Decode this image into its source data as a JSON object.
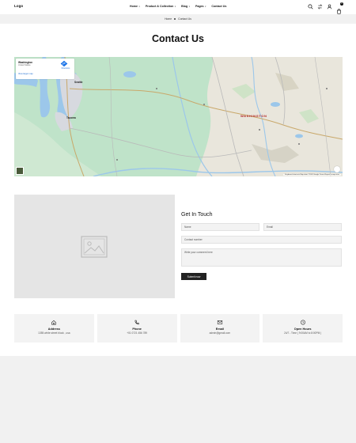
{
  "header": {
    "logo": "Logo",
    "nav": [
      {
        "label": "Home",
        "has_dropdown": true
      },
      {
        "label": "Product & Collection",
        "has_dropdown": true
      },
      {
        "label": "Blog",
        "has_dropdown": true
      },
      {
        "label": "Pages",
        "has_dropdown": true
      },
      {
        "label": "Contact Us",
        "has_dropdown": false
      }
    ],
    "icons": [
      "search-icon",
      "compare-icon",
      "account-icon",
      "cart-icon"
    ],
    "cart_count": "0"
  },
  "breadcrumb": {
    "items": [
      "Home",
      "Contact Us"
    ]
  },
  "page_title": "Contact Us",
  "map": {
    "card_title": "Washington",
    "card_subtitle": "United States",
    "directions_label": "Directions",
    "view_larger": "View larger map",
    "city_label": "Seattle",
    "city2_label": "Tacoma",
    "state_label": "WASHINGTON",
    "footer": "Keyboard shortcuts   Map data ©2024 Google   Terms   Report a map error"
  },
  "form": {
    "title": "Get In Touch",
    "name_placeholder": "Name",
    "email_placeholder": "Email",
    "contact_placeholder": "Contact number",
    "comment_placeholder": "Write your comment here",
    "submit_label": "Submit now"
  },
  "info_cards": [
    {
      "icon": "home-icon",
      "title": "Address",
      "value": "1355 white street block , usa"
    },
    {
      "icon": "phone-icon",
      "title": "Phone",
      "value": "+01 0721 456 789"
    },
    {
      "icon": "mail-icon",
      "title": "Email",
      "value": "admin@gmail.com"
    },
    {
      "icon": "clock-icon",
      "title": "Open Hours",
      "value": "24/7 - Time ( 9:00AM to 8:00PM )"
    }
  ],
  "colors": {
    "accent": "#222222",
    "map_green": "#b9e1c5",
    "placeholder_gray": "#e5e5e5"
  }
}
